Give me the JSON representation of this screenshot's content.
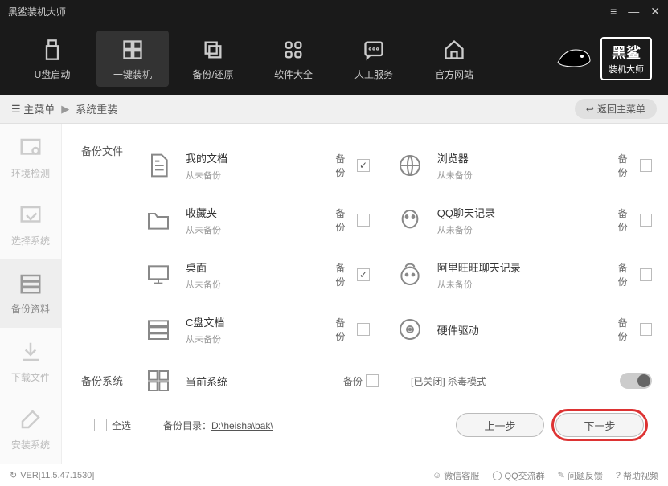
{
  "titlebar": {
    "app_name": "黑鲨装机大师"
  },
  "topnav": {
    "items": [
      {
        "label": "U盘启动"
      },
      {
        "label": "一键装机"
      },
      {
        "label": "备份/还原"
      },
      {
        "label": "软件大全"
      },
      {
        "label": "人工服务"
      },
      {
        "label": "官方网站"
      }
    ],
    "brand_line1": "黑鲨",
    "brand_line2": "装机大师"
  },
  "breadcrumb": {
    "root": "主菜单",
    "current": "系统重装",
    "back": "返回主菜单"
  },
  "steps": [
    {
      "label": "环境检测"
    },
    {
      "label": "选择系统"
    },
    {
      "label": "备份资料"
    },
    {
      "label": "下载文件"
    },
    {
      "label": "安装系统"
    }
  ],
  "section": {
    "files": "备份文件",
    "system": "备份系统",
    "backup_label": "备份",
    "never_backed": "从未备份"
  },
  "items": {
    "docs": "我的文档",
    "browsers": "浏览器",
    "favs": "收藏夹",
    "qq": "QQ聊天记录",
    "desktop": "桌面",
    "aliww": "阿里旺旺聊天记录",
    "cdisk": "C盘文档",
    "hardware": "硬件驱动",
    "cur_sys": "当前系统",
    "virus_mode": "[已关闭] 杀毒模式"
  },
  "bottom": {
    "select_all": "全选",
    "dir_label": "备份目录：",
    "dir_path": "D:\\heisha\\bak\\",
    "prev": "上一步",
    "next": "下一步"
  },
  "footer": {
    "version": "VER[11.5.47.1530]",
    "links": {
      "wechat": "微信客服",
      "qq": "QQ交流群",
      "feedback": "问题反馈",
      "help": "帮助视频"
    }
  }
}
